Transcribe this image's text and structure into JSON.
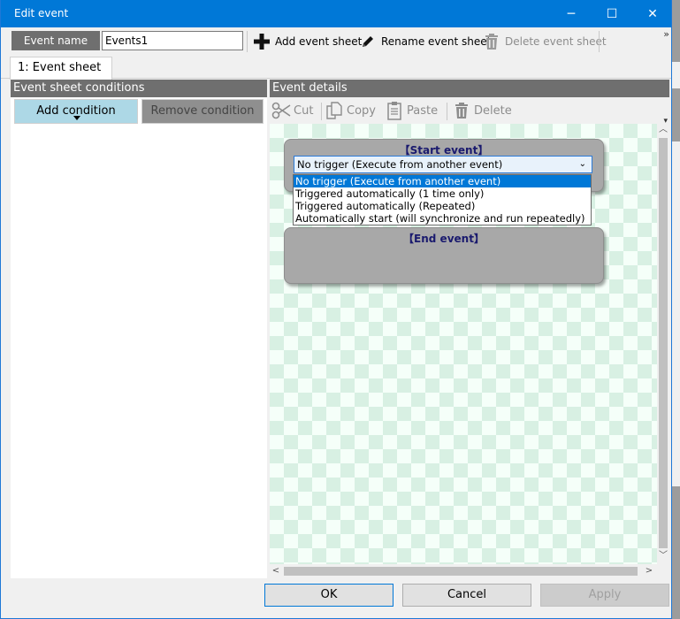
{
  "window": {
    "title": "Edit event",
    "minimize": "─",
    "maximize": "☐",
    "close": "✕"
  },
  "toolbar": {
    "event_name_label": "Event name",
    "event_name_value": "Events1",
    "add_sheet": "Add event sheet",
    "rename_sheet": "Rename event sheet",
    "delete_sheet": "Delete event sheet",
    "overflow": "»"
  },
  "tabs": [
    {
      "label": "1: Event sheet"
    }
  ],
  "conditions_panel": {
    "header": "Event sheet conditions",
    "add_condition": "Add condition",
    "remove_condition": "Remove condition"
  },
  "details_panel": {
    "header": "Event details",
    "cut": "Cut",
    "copy": "Copy",
    "paste": "Paste",
    "delete": "Delete"
  },
  "start_event": {
    "title": "【Start event】",
    "selected": "No trigger (Execute from another event)",
    "options": [
      "No trigger (Execute from another event)",
      "Triggered automatically (1 time only)",
      "Triggered automatically (Repeated)",
      "Automatically start (will synchronize and run repeatedly)"
    ]
  },
  "end_event": {
    "title": "【End event】"
  },
  "buttons": {
    "ok": "OK",
    "cancel": "Cancel",
    "apply": "Apply"
  },
  "colors": {
    "titlebar": "#0078d7",
    "header_gray": "#6f6f6f",
    "add_condition_bg": "#add8e6",
    "selection": "#0078d7"
  }
}
